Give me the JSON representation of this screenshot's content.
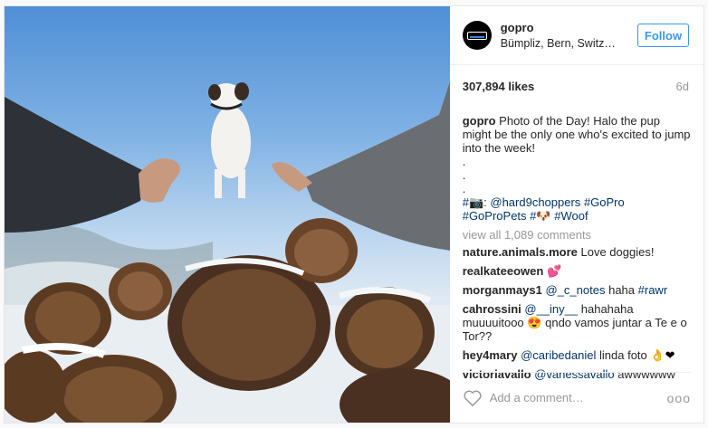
{
  "post": {
    "username": "gopro",
    "location": "Bümpliz, Bern, Switz…",
    "follow_label": "Follow",
    "likes": "307,894 likes",
    "age": "6d",
    "caption_user": "gopro",
    "caption_text": "Photo of the Day! Halo the pup might be the only one who's excited to jump into the week!",
    "caption_dots": [
      ".",
      ".",
      "."
    ],
    "caption_tag_prefix": "#",
    "caption_mention": "@hard9choppers",
    "caption_tags": [
      "#GoPro",
      "#GoProPets",
      "#",
      "#Woof"
    ],
    "view_all": "view all 1,089 comments",
    "comments": [
      {
        "user": "nature.animals.more",
        "text": "Love doggies!"
      },
      {
        "user": "realkateeowen",
        "text": "",
        "emoji": "💕"
      },
      {
        "user": "morganmays1",
        "mention": "@_c_notes",
        "text": "haha",
        "tag": "#rawr"
      },
      {
        "user": "cahrossini",
        "mention": "@__iny__",
        "text": "hahahaha muuuuitooo",
        "emoji": "😍",
        "text2": "qndo vamos juntar a Te e o Tor??"
      },
      {
        "user": "hey4mary",
        "mention": "@caribedaniel",
        "text": "linda foto",
        "emoji": "👌",
        "emoji2": "❤"
      },
      {
        "user": "victoriavallo",
        "mention": "@vanessavallo",
        "text": "awwwwww"
      }
    ],
    "add_comment_placeholder": "Add a comment…",
    "more_label": "ooo"
  },
  "icons": {
    "heart": "heart-outline-icon",
    "more": "more-options-icon"
  },
  "colors": {
    "link": "#003569",
    "follow": "#3897f0",
    "muted": "#999999"
  }
}
